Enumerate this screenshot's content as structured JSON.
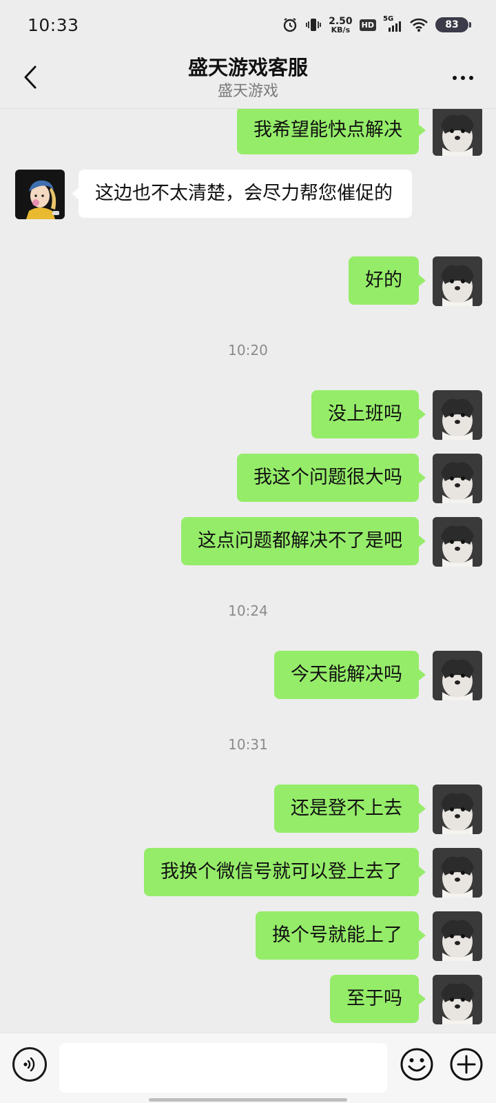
{
  "status_bar": {
    "time": "10:33",
    "net_speed_value": "2.50",
    "net_speed_unit": "KB/s",
    "hd_badge": "HD",
    "network_type": "5G",
    "battery_level": "83",
    "icons": [
      "alarm-icon",
      "vibrate-icon",
      "signal-icon",
      "wifi-icon",
      "battery-icon"
    ]
  },
  "header": {
    "title": "盛天游戏客服",
    "subtitle": "盛天游戏",
    "back_icon": "chevron-left-icon",
    "more_icon": "more-dots-icon"
  },
  "messages": [
    {
      "type": "msg",
      "sender": "me",
      "text": "我希望能快点解决"
    },
    {
      "type": "msg",
      "sender": "them",
      "text": "这边也不太清楚，会尽力帮您催促的"
    },
    {
      "type": "msg",
      "sender": "me",
      "text": "好的"
    },
    {
      "type": "time",
      "text": "10:20"
    },
    {
      "type": "msg",
      "sender": "me",
      "text": "没上班吗"
    },
    {
      "type": "msg",
      "sender": "me",
      "text": "我这个问题很大吗"
    },
    {
      "type": "msg",
      "sender": "me",
      "text": "这点问题都解决不了是吧"
    },
    {
      "type": "time",
      "text": "10:24"
    },
    {
      "type": "msg",
      "sender": "me",
      "text": "今天能解决吗"
    },
    {
      "type": "time",
      "text": "10:31"
    },
    {
      "type": "msg",
      "sender": "me",
      "text": "还是登不上去"
    },
    {
      "type": "msg",
      "sender": "me",
      "text": "我换个微信号就可以登上去了"
    },
    {
      "type": "msg",
      "sender": "me",
      "text": "换个号就能上了"
    },
    {
      "type": "msg",
      "sender": "me",
      "text": "至于吗"
    }
  ],
  "input_bar": {
    "input_value": "",
    "icons": [
      "voice-icon",
      "emoji-icon",
      "plus-icon"
    ]
  },
  "colors": {
    "background": "#ededed",
    "my_bubble": "#95ec69",
    "their_bubble": "#ffffff"
  }
}
